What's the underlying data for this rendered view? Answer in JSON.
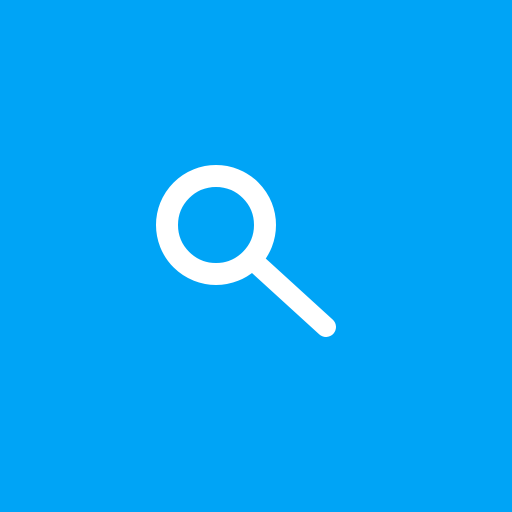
{
  "app": {
    "background_color": "#00A4F6",
    "icon": {
      "name": "search-icon",
      "color": "#FFFFFF"
    }
  }
}
